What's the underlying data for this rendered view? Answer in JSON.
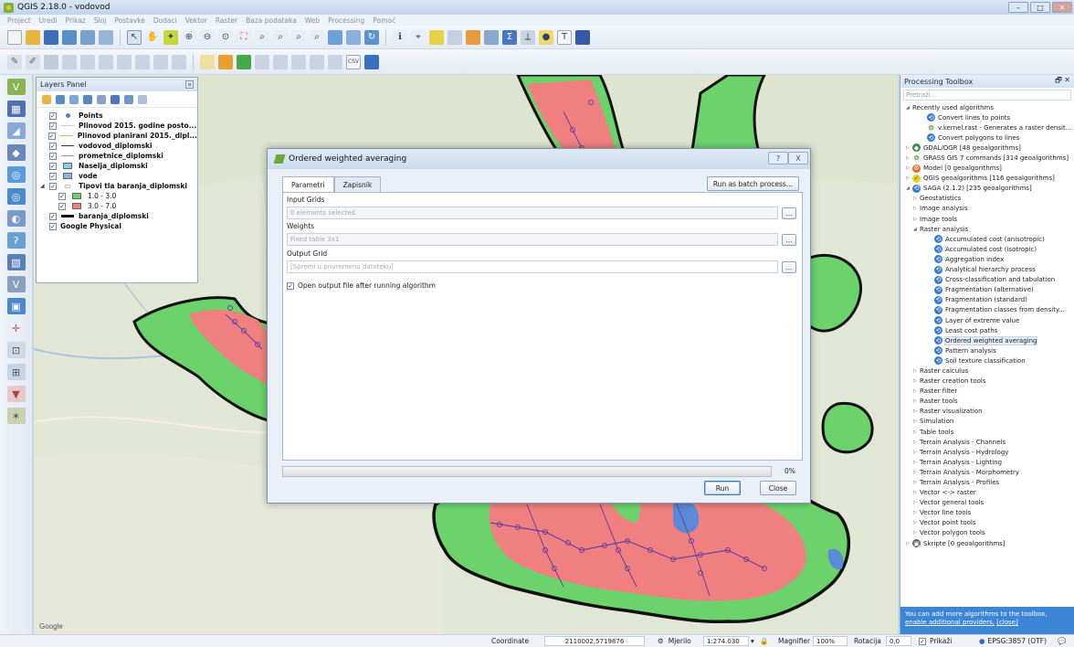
{
  "window": {
    "title": "QGIS 2.18.0 - vodovod"
  },
  "menubar": [
    "Project",
    "Uredi",
    "Prikaz",
    "Sloj",
    "Postavke",
    "Dodaci",
    "Vektor",
    "Raster",
    "Baza podataka",
    "Web",
    "Processing",
    "Pomoć"
  ],
  "layers_panel": {
    "title": "Layers Panel",
    "layers": [
      {
        "name": "Points",
        "checked": true,
        "symbol": "dot",
        "color": "#5b7ac8"
      },
      {
        "name": "Plinovod 2015. godine posto...",
        "checked": true,
        "symbol": "line",
        "color": "#cccccc"
      },
      {
        "name": "Plinovod planirani 2015._dipl...",
        "checked": true,
        "symbol": "line",
        "color": "#d9b06a"
      },
      {
        "name": "vodovod_diplomski",
        "checked": true,
        "symbol": "line",
        "color": "#333366"
      },
      {
        "name": "prometnice_diplomski",
        "checked": true,
        "symbol": "line",
        "color": "#e87a7a"
      },
      {
        "name": "Naselja_diplomski",
        "checked": true,
        "symbol": "box",
        "color": "#7fd6e6"
      },
      {
        "name": "vode",
        "checked": true,
        "symbol": "box",
        "color": "#8fb3e6"
      },
      {
        "name": "Tipovi tla baranja_diplomski",
        "checked": true,
        "symbol": "none",
        "color": ""
      },
      {
        "name": "1.0 - 3.0",
        "checked": true,
        "symbol": "box",
        "color": "#6cd36c",
        "legend": true
      },
      {
        "name": "3.0 - 7.0",
        "checked": true,
        "symbol": "box",
        "color": "#f08080",
        "legend": true
      },
      {
        "name": "baranja_diplomski",
        "checked": true,
        "symbol": "line",
        "color": "#111111"
      },
      {
        "name": "Google Physical",
        "checked": true,
        "symbol": "none",
        "color": ""
      }
    ]
  },
  "dialog": {
    "title": "Ordered weighted averaging",
    "tabs": [
      "Parametri",
      "Zapisnik"
    ],
    "batch_button": "Run as batch process...",
    "params": [
      {
        "label": "Input Grids",
        "value": "0 elements selected"
      },
      {
        "label": "Weights",
        "value": "Fixed table 3x1"
      },
      {
        "label": "Output Grid",
        "value": "[Spremi u privremenu datoteku]"
      }
    ],
    "dots_label": "...",
    "open_output_label": "Open output file after running algorithm",
    "progress_text": "0%",
    "run_label": "Run",
    "close_label": "Close",
    "help_label": "?",
    "x_label": "X"
  },
  "toolbox": {
    "title": "Processing Toolbox",
    "search_placeholder": "Pretraži...",
    "info_text": "You can add more algorithms to the toolbox,",
    "info_link": "enable additional providers.",
    "info_close": "[close]",
    "rows": [
      {
        "level": 0,
        "arrow": "◢",
        "icon": "",
        "label": "Recently used algorithms"
      },
      {
        "level": 2,
        "arrow": "",
        "icon": "saga",
        "label": "Convert lines to points"
      },
      {
        "level": 2,
        "arrow": "",
        "icon": "grass",
        "label": "v.kernel.rast - Generates a raster densit..."
      },
      {
        "level": 2,
        "arrow": "",
        "icon": "saga",
        "label": "Convert polygons to lines"
      },
      {
        "level": 0,
        "arrow": "▷",
        "icon": "gdal",
        "label": "GDAL/OGR [48 geoalgorithms]"
      },
      {
        "level": 0,
        "arrow": "▷",
        "icon": "grass",
        "label": "GRASS GIS 7 commands [314 geoalgorithms]"
      },
      {
        "level": 0,
        "arrow": "▷",
        "icon": "model",
        "label": "Model [0 geoalgorithms]"
      },
      {
        "level": 0,
        "arrow": "▷",
        "icon": "qgis",
        "label": "QGIS geoalgorithms [116 geoalgorithms]"
      },
      {
        "level": 0,
        "arrow": "◢",
        "icon": "saga",
        "label": "SAGA (2.1.2) [235 geoalgorithms]"
      },
      {
        "level": 1,
        "arrow": "▷",
        "icon": "",
        "label": "Geostatistics"
      },
      {
        "level": 1,
        "arrow": "▷",
        "icon": "",
        "label": "Image analysis"
      },
      {
        "level": 1,
        "arrow": "▷",
        "icon": "",
        "label": "Image tools"
      },
      {
        "level": 1,
        "arrow": "◢",
        "icon": "",
        "label": "Raster analysis"
      },
      {
        "level": 3,
        "arrow": "",
        "icon": "saga",
        "label": "Accumulated cost (anisotropic)"
      },
      {
        "level": 3,
        "arrow": "",
        "icon": "saga",
        "label": "Accumulated cost (isotropic)"
      },
      {
        "level": 3,
        "arrow": "",
        "icon": "saga",
        "label": "Aggregation index"
      },
      {
        "level": 3,
        "arrow": "",
        "icon": "saga",
        "label": "Analytical hierarchy process"
      },
      {
        "level": 3,
        "arrow": "",
        "icon": "saga",
        "label": "Cross-classification and tabulation"
      },
      {
        "level": 3,
        "arrow": "",
        "icon": "saga",
        "label": "Fragmentation (alternative)"
      },
      {
        "level": 3,
        "arrow": "",
        "icon": "saga",
        "label": "Fragmentation (standard)"
      },
      {
        "level": 3,
        "arrow": "",
        "icon": "saga",
        "label": "Fragmentation classes from density..."
      },
      {
        "level": 3,
        "arrow": "",
        "icon": "saga",
        "label": "Layer of extreme value"
      },
      {
        "level": 3,
        "arrow": "",
        "icon": "saga",
        "label": "Least cost paths"
      },
      {
        "level": 3,
        "arrow": "",
        "icon": "saga",
        "label": "Ordered weighted averaging",
        "selected": true
      },
      {
        "level": 3,
        "arrow": "",
        "icon": "saga",
        "label": "Pattern analysis"
      },
      {
        "level": 3,
        "arrow": "",
        "icon": "saga",
        "label": "Soil texture classification"
      },
      {
        "level": 1,
        "arrow": "▷",
        "icon": "",
        "label": "Raster calculus"
      },
      {
        "level": 1,
        "arrow": "▷",
        "icon": "",
        "label": "Raster creation tools"
      },
      {
        "level": 1,
        "arrow": "▷",
        "icon": "",
        "label": "Raster filter"
      },
      {
        "level": 1,
        "arrow": "▷",
        "icon": "",
        "label": "Raster tools"
      },
      {
        "level": 1,
        "arrow": "▷",
        "icon": "",
        "label": "Raster visualization"
      },
      {
        "level": 1,
        "arrow": "▷",
        "icon": "",
        "label": "Simulation"
      },
      {
        "level": 1,
        "arrow": "▷",
        "icon": "",
        "label": "Table tools"
      },
      {
        "level": 1,
        "arrow": "▷",
        "icon": "",
        "label": "Terrain Analysis - Channels"
      },
      {
        "level": 1,
        "arrow": "▷",
        "icon": "",
        "label": "Terrain Analysis - Hydrology"
      },
      {
        "level": 1,
        "arrow": "▷",
        "icon": "",
        "label": "Terrain Analysis - Lighting"
      },
      {
        "level": 1,
        "arrow": "▷",
        "icon": "",
        "label": "Terrain Analysis - Morphometry"
      },
      {
        "level": 1,
        "arrow": "▷",
        "icon": "",
        "label": "Terrain Analysis - Profiles"
      },
      {
        "level": 1,
        "arrow": "▷",
        "icon": "",
        "label": "Vector <-> raster"
      },
      {
        "level": 1,
        "arrow": "▷",
        "icon": "",
        "label": "Vector general tools"
      },
      {
        "level": 1,
        "arrow": "▷",
        "icon": "",
        "label": "Vector line tools"
      },
      {
        "level": 1,
        "arrow": "▷",
        "icon": "",
        "label": "Vector point tools"
      },
      {
        "level": 1,
        "arrow": "▷",
        "icon": "",
        "label": "Vector polygon tools"
      },
      {
        "level": 0,
        "arrow": "▷",
        "icon": "script",
        "label": "Skripte [0 geoalgorithms]"
      }
    ]
  },
  "statusbar": {
    "coordinate_label": "Coordinate",
    "coordinate_value": "2110002,5719876",
    "scale_label": "Mjerilo",
    "scale_value": "1:274.030",
    "magnifier_label": "Magnifier",
    "magnifier_value": "100%",
    "rotation_label": "Rotacija",
    "rotation_value": "0,0",
    "render_label": "Prikaži",
    "crs_label": "EPSG:3857 (OTF)"
  },
  "map": {
    "attribution": "Google"
  },
  "colors": {
    "soil_low": "#6cd36c",
    "soil_high": "#f08080",
    "boundary": "#111111",
    "accent": "#3b86d6"
  }
}
